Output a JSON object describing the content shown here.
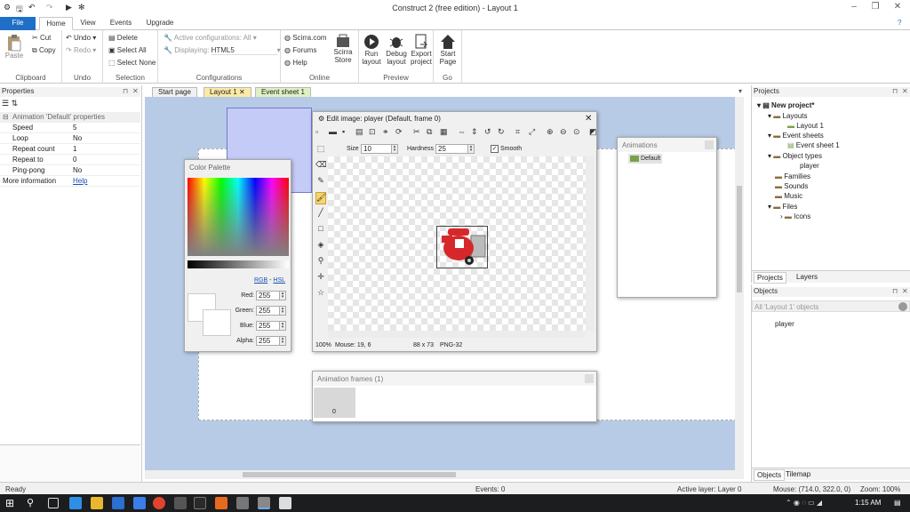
{
  "window": {
    "title": "Construct 2  (free edition) - Layout 1"
  },
  "tabs": {
    "file": "File",
    "home": "Home",
    "view": "View",
    "events": "Events",
    "upgrade": "Upgrade"
  },
  "ribbon": {
    "paste": "Paste",
    "cut": "Cut",
    "copy": "Copy",
    "clipboard": "Clipboard",
    "undo": "Undo",
    "redo": "Redo",
    "undo_group": "Undo",
    "delete": "Delete",
    "select_all": "Select All",
    "select_none": "Select None",
    "selection": "Selection",
    "active_config": "Active configurations: All",
    "displaying_label": "Displaying:",
    "displaying_value": "HTML5",
    "configurations": "Configurations",
    "scirra": "Scirra.com",
    "forums": "Forums",
    "help": "Help",
    "scirra_store_1": "Scirra",
    "scirra_store_2": "Store",
    "online": "Online",
    "run_1": "Run",
    "run_2": "layout",
    "debug_1": "Debug",
    "debug_2": "layout",
    "export_1": "Export",
    "export_2": "project",
    "preview": "Preview",
    "start_1": "Start",
    "start_2": "Page",
    "go": "Go"
  },
  "properties": {
    "title": "Properties",
    "section": "Animation 'Default' properties",
    "rows": [
      {
        "k": "Speed",
        "v": "5"
      },
      {
        "k": "Loop",
        "v": "No"
      },
      {
        "k": "Repeat count",
        "v": "1"
      },
      {
        "k": "Repeat to",
        "v": "0"
      },
      {
        "k": "Ping-pong",
        "v": "No"
      }
    ],
    "more_info": "More information",
    "help_link": "Help"
  },
  "doc_tabs": {
    "start_page": "Start page",
    "layout1": "Layout 1",
    "event_sheet1": "Event sheet 1"
  },
  "edit_image": {
    "title": "Edit image: player (Default, frame 0)",
    "size_label": "Size",
    "size_value": "10",
    "hardness_label": "Hardness",
    "hardness_value": "25",
    "smooth_label": "Smooth",
    "status_zoom": "100%",
    "status_mouse": "Mouse: 19, 6",
    "status_dims": "88 x 73",
    "status_format": "PNG-32"
  },
  "color_palette": {
    "title": "Color Palette",
    "rgb": "RGB",
    "sep": "-",
    "hsl": "HSL",
    "red_label": "Red:",
    "red": "255",
    "green_label": "Green:",
    "green": "255",
    "blue_label": "Blue:",
    "blue": "255",
    "alpha_label": "Alpha:",
    "alpha": "255"
  },
  "animations": {
    "title": "Animations",
    "item": "Default"
  },
  "anim_frames": {
    "title": "Animation frames",
    "count": "(1)",
    "frame0": "0"
  },
  "projects": {
    "title": "Projects",
    "root": "New project*",
    "layouts": "Layouts",
    "layout1": "Layout 1",
    "event_sheets": "Event sheets",
    "event_sheet1": "Event sheet 1",
    "object_types": "Object types",
    "player": "player",
    "families": "Families",
    "sounds": "Sounds",
    "music": "Music",
    "files": "Files",
    "icons": "Icons",
    "tab_projects": "Projects",
    "tab_layers": "Layers"
  },
  "objects": {
    "title": "Objects",
    "filter": "All 'Layout 1' objects",
    "item": "player",
    "tab_objects": "Objects",
    "tab_tilemap": "Tilemap"
  },
  "status": {
    "ready": "Ready",
    "events": "Events: 0",
    "active_layer": "Active layer: Layer 0",
    "mouse": "Mouse: (714.0, 322.0, 0)",
    "zoom": "Zoom: 100%"
  },
  "taskbar": {
    "time": "1:15 AM"
  },
  "colors": {
    "file_tab": "#1f6fc6",
    "layout_bg": "#b7cbe6",
    "sprite_red": "#d6282b"
  }
}
